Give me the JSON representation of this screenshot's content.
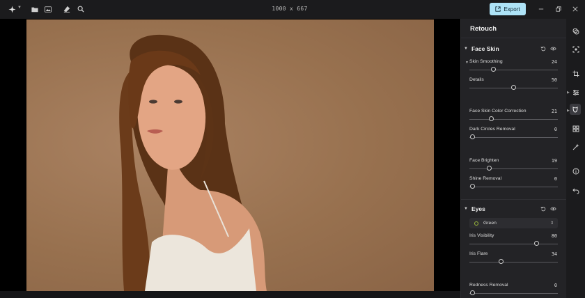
{
  "toolbar": {
    "image_dims": "1000 x 667",
    "export_label": "Export",
    "icons": [
      "sparkle-icon",
      "folder-icon",
      "gallery-icon",
      "eraser-icon",
      "zoom-icon"
    ]
  },
  "panel": {
    "title": "Retouch",
    "face_skin": {
      "title": "Face Skin",
      "controls": [
        {
          "label": "Skin Smoothing",
          "value": "24",
          "fraction": 0.26
        },
        {
          "label": "Details",
          "value": "50",
          "fraction": 0.5
        },
        {
          "label": "Face Skin Color Correction",
          "value": "21",
          "fraction": 0.23
        },
        {
          "label": "Dark Circles Removal",
          "value": "0",
          "fraction": 0.0
        },
        {
          "label": "Face Brighten",
          "value": "19",
          "fraction": 0.21
        },
        {
          "label": "Shine Removal",
          "value": "0",
          "fraction": 0.0
        }
      ]
    },
    "eyes": {
      "title": "Eyes",
      "color_select": "Green",
      "controls": [
        {
          "label": "Iris Visibility",
          "value": "80",
          "fraction": 0.78
        },
        {
          "label": "Iris Flare",
          "value": "34",
          "fraction": 0.35
        },
        {
          "label": "Redness Removal",
          "value": "0",
          "fraction": 0.0
        }
      ]
    }
  },
  "colors": {
    "accent": "#aee3f7",
    "panel_bg": "#232326",
    "app_bg": "#1b1b1d"
  }
}
